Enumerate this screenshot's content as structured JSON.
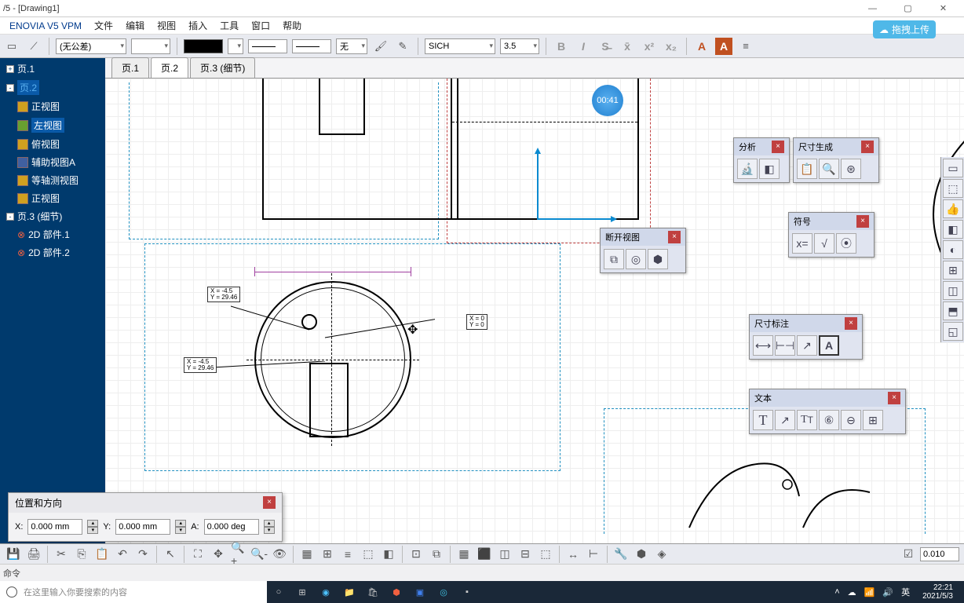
{
  "window": {
    "title": "/5 - [Drawing1]"
  },
  "menubar": {
    "app": "ENOVIA V5 VPM",
    "items": [
      "文件",
      "编辑",
      "视图",
      "插入",
      "工具",
      "窗口",
      "帮助"
    ]
  },
  "upload": {
    "label": "拖拽上传"
  },
  "toolbar": {
    "tolerance": "(无公差)",
    "nostyle": "无",
    "font": "SICH",
    "size": "3.5",
    "stepval": "0.010"
  },
  "tree": {
    "items": [
      {
        "label": "页.1",
        "indent": 0
      },
      {
        "label": "页.2",
        "indent": 0,
        "active": true
      },
      {
        "label": "正视图",
        "indent": 1
      },
      {
        "label": "左视图",
        "indent": 1,
        "active": true
      },
      {
        "label": "俯视图",
        "indent": 1
      },
      {
        "label": "辅助视图A",
        "indent": 1
      },
      {
        "label": "等轴测视图",
        "indent": 1
      },
      {
        "label": "正视图",
        "indent": 1
      },
      {
        "label": "页.3 (细节)",
        "indent": 0
      },
      {
        "label": "2D 部件.1",
        "indent": 1
      },
      {
        "label": "2D 部件.2",
        "indent": 1
      }
    ]
  },
  "tabs": {
    "items": [
      "页.1",
      "页.2",
      "页.3 (细节)"
    ],
    "active": 1
  },
  "timer": "00:41",
  "floating": {
    "analysis": "分析",
    "dimgen": "尺寸生成",
    "break": "断开视图",
    "symbol": "符号",
    "dimann": "尺寸标注",
    "text": "文本"
  },
  "pos_panel": {
    "title": "位置和方向",
    "x_label": "X:",
    "x_val": "0.000 mm",
    "y_label": "Y:",
    "y_val": "0.000 mm",
    "a_label": "A:",
    "a_val": "0.000 deg"
  },
  "labels": {
    "coord1": "X = -4.5\nY = 29.46",
    "coord2": "X = -4.5\nY = 29.46",
    "coord3": "X = 0\nY = 0"
  },
  "status": {
    "cmd": "命令"
  },
  "taskbar": {
    "search_placeholder": "在这里输入你要搜索的内容",
    "ime": "英",
    "time": "22:21",
    "date": "2021/5/3"
  }
}
